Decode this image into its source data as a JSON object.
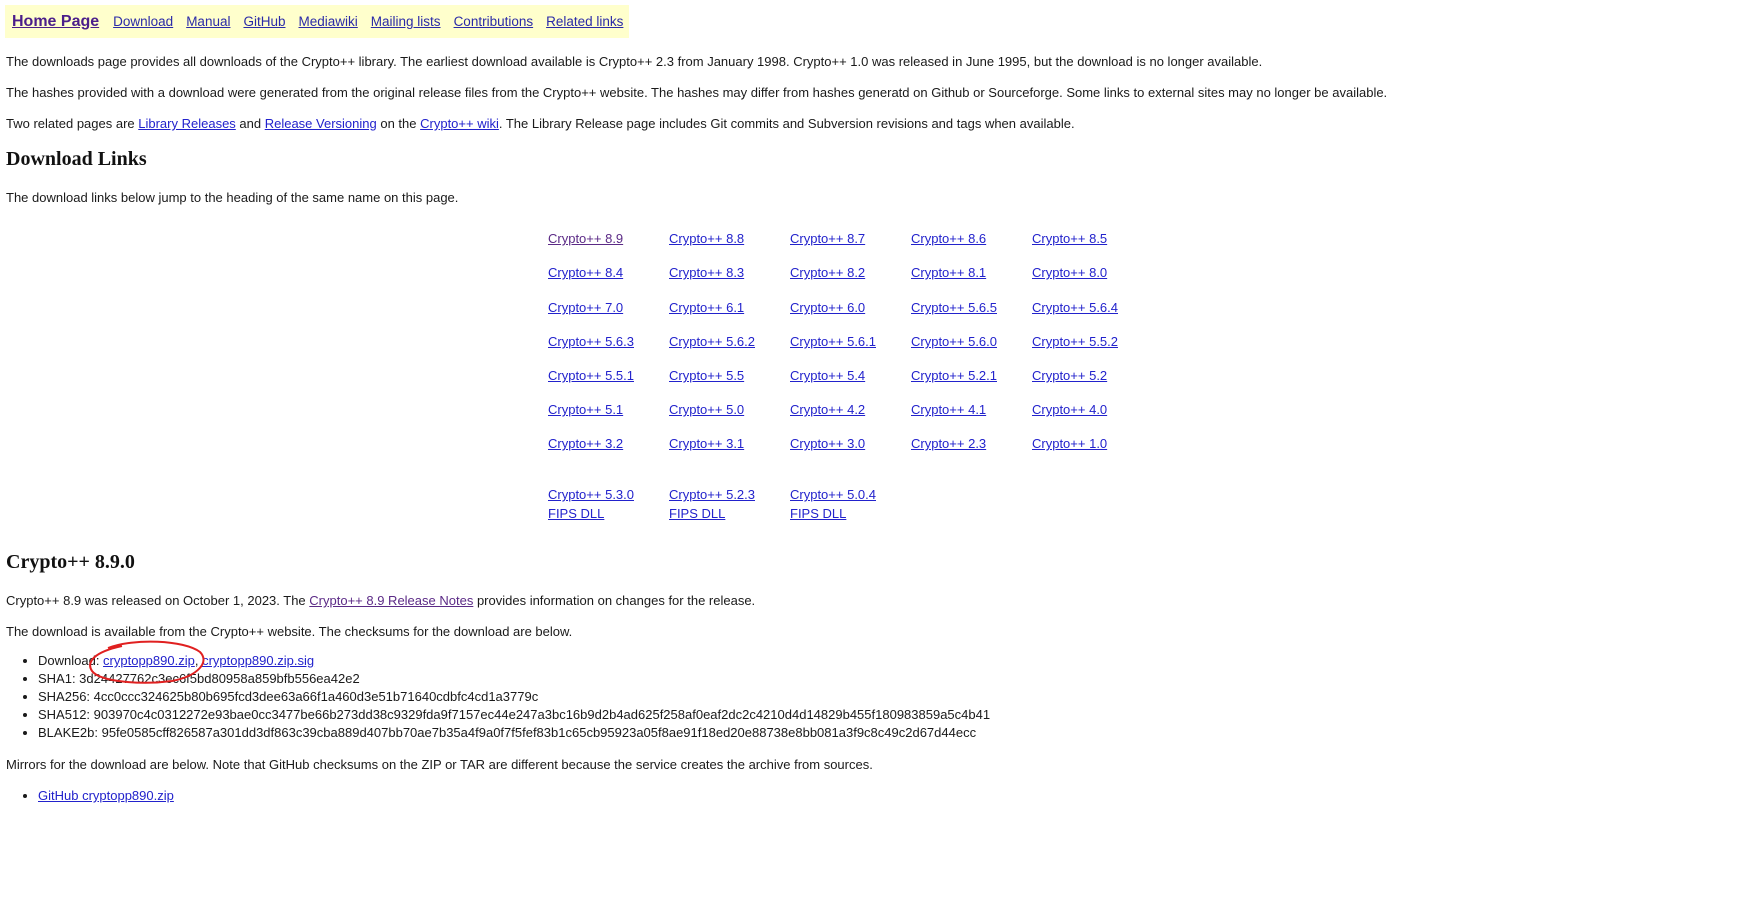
{
  "nav": {
    "home": "Home Page",
    "links": [
      "Download",
      "Manual",
      "GitHub",
      "Mediawiki",
      "Mailing lists",
      "Contributions",
      "Related links"
    ]
  },
  "intro": {
    "p1": "The downloads page provides all downloads of the Crypto++ library. The earliest download available is Crypto++ 2.3 from January 1998. Crypto++ 1.0 was released in June 1995, but the download is no longer available.",
    "p2": "The hashes provided with a download were generated from the original release files from the Crypto++ website. The hashes may differ from hashes generatd on Github or Sourceforge. Some links to external sites may no longer be available.",
    "p3": {
      "t1": "Two related pages are ",
      "link1": "Library Releases",
      "t2": " and ",
      "link2": "Release Versioning",
      "t3": " on the ",
      "link3": "Crypto++ wiki",
      "t4": ". The Library Release page includes Git commits and Subversion revisions and tags when available."
    }
  },
  "download_links": {
    "heading": "Download Links",
    "intro": "The download links below jump to the heading of the same name on this page.",
    "rows": [
      [
        "Crypto++ 8.9",
        "Crypto++ 8.8",
        "Crypto++ 8.7",
        "Crypto++ 8.6",
        "Crypto++ 8.5"
      ],
      [
        "Crypto++ 8.4",
        "Crypto++ 8.3",
        "Crypto++ 8.2",
        "Crypto++ 8.1",
        "Crypto++ 8.0"
      ],
      [
        "Crypto++ 7.0",
        "Crypto++ 6.1",
        "Crypto++ 6.0",
        "Crypto++ 5.6.5",
        "Crypto++ 5.6.4"
      ],
      [
        "Crypto++ 5.6.3",
        "Crypto++ 5.6.2",
        "Crypto++ 5.6.1",
        "Crypto++ 5.6.0",
        "Crypto++ 5.5.2"
      ],
      [
        "Crypto++ 5.5.1",
        "Crypto++ 5.5",
        "Crypto++ 5.4",
        "Crypto++ 5.2.1",
        "Crypto++ 5.2"
      ],
      [
        "Crypto++ 5.1",
        "Crypto++ 5.0",
        "Crypto++ 4.2",
        "Crypto++ 4.1",
        "Crypto++ 4.0"
      ],
      [
        "Crypto++ 3.2",
        "Crypto++ 3.1",
        "Crypto++ 3.0",
        "Crypto++ 2.3",
        "Crypto++ 1.0"
      ]
    ],
    "fips": [
      {
        "version": "Crypto++ 5.3.0",
        "label": "FIPS DLL"
      },
      {
        "version": "Crypto++ 5.2.3",
        "label": "FIPS DLL"
      },
      {
        "version": "Crypto++ 5.0.4",
        "label": "FIPS DLL"
      }
    ]
  },
  "release": {
    "heading": "Crypto++ 8.9.0",
    "p1": {
      "t1": "Crypto++ 8.9 was released on October 1, 2023. The ",
      "link": "Crypto++ 8.9 Release Notes",
      "t2": " provides information on changes for the release."
    },
    "p2": "The download is available from the Crypto++ website. The checksums for the download are below.",
    "download_label": "Download: ",
    "zip": "cryptopp890.zip",
    "sep": ", ",
    "sig": "cryptopp890.zip.sig",
    "sha1": "SHA1: 3d24427762c3ec6f5bd80958a859bfb556ea42e2",
    "sha256": "SHA256: 4cc0ccc324625b80b695fcd3dee63a66f1a460d3e51b71640cdbfc4cd1a3779c",
    "sha512": "SHA512: 903970c4c0312272e93bae0cc3477be66b273dd38c9329fda9f7157ec44e247a3bc16b9d2b4ad625f258af0eaf2dc2c4210d4d14829b455f180983859a5c4b41",
    "blake2b": "BLAKE2b: 95fe0585cff826587a301dd3df863c39cba889d407bb70ae7b35a4f9a0f7f5fef83b1c65cb95923a05f8ae91f18ed20e88738e8bb081a3f9c8c49c2d67d44ecc",
    "mirrors_text": "Mirrors for the download are below. Note that GitHub checksums on the ZIP or TAR are different because the service creates the archive from sources.",
    "mirror_link": "GitHub cryptopp890.zip"
  },
  "colors": {
    "nav_bg": "#ffffcc",
    "link": "#2222cc",
    "visited": "#5b2a86",
    "annotation": "#e02020"
  }
}
